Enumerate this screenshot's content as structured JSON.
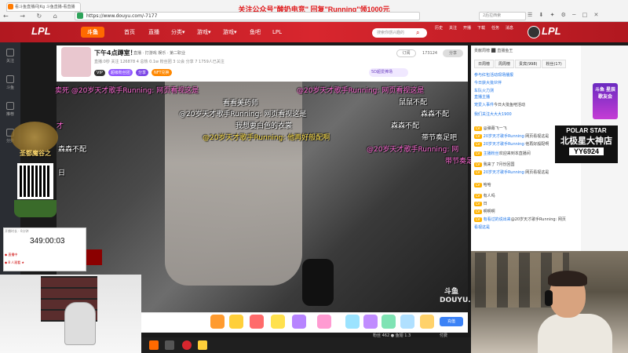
{
  "browser": {
    "tab_title": "看斗鱼直播间|Kg 斗鱼直播-看直播",
    "url": "https://www.douyu.com/-7177",
    "search_placeholder": "2后拉西索",
    "nav_glyphs": "← → ↻ ⌂"
  },
  "banner": {
    "text": "关注公众号\"酸奶电竞\" 回复\"Running\"领1000元"
  },
  "douyu_header": {
    "logo_left": "LPL",
    "logo_right": "LPL",
    "brand": "斗鱼",
    "nav": [
      "首页",
      "直播",
      "分类▾",
      "游戏▾",
      "游戏▾",
      "鱼吧",
      "LPL"
    ],
    "search_placeholder": "搜索你感兴趣的",
    "icons": [
      "历史",
      "关注",
      "开播",
      "下载",
      "任务",
      "消息"
    ]
  },
  "sidebar": {
    "items": [
      "关注",
      "斗鱼",
      "推荐",
      "分类",
      "游戏",
      "更多"
    ]
  },
  "room": {
    "title": "下午4点蹲室！",
    "meta": "直播 · 打游戏  娱乐 · 第二职业",
    "stats": "直播:0秒  关注 126878  4 总热  0.1w  粉丝团  3 公会  分享  7 1759人已关注",
    "badges": [
      "VIP",
      "超级粉丝团",
      "分享",
      "NFT兑换"
    ],
    "subscribe_label": "订阅",
    "follow_count": "173124",
    "share_label": "分享",
    "actions": "5D超爱捧场  分享  ☆  ⋯",
    "hot_label": "5D超爱捧场"
  },
  "danmu": [
    {
      "text": "卖死 @20岁天才歌手Running: 网页看视这是",
      "color": "#ff6bd6"
    },
    {
      "text": "@20岁天才歌手Running: 网页看视这是",
      "color": "#ff6bd6"
    },
    {
      "text": "看看美药师",
      "color": "#ffffff"
    },
    {
      "text": "@20岁天才歌手Running: 网页看视这是",
      "color": "#ffffff"
    },
    {
      "text": "我想要白色的衣裳",
      "color": "#ffffff"
    },
    {
      "text": "森森不配",
      "color": "#ffffff"
    },
    {
      "text": "森森不配",
      "color": "#ffffff"
    },
    {
      "text": "@20岁天才歌手Running: 他再好般配啊",
      "color": "#ffe14d"
    },
    {
      "text": "@20岁天才歌手Running: 网",
      "color": "#ff6bd6"
    },
    {
      "text": "带节奏足吧",
      "color": "#ffffff"
    },
    {
      "text": "才",
      "color": "#ff6bd6"
    },
    {
      "text": "森森不配",
      "color": "#ffffff"
    },
    {
      "text": "日",
      "color": "#ffffff"
    },
    {
      "text": "带节奏足吧",
      "color": "#ff6bd6"
    },
    {
      "text": "鼠鼠不配",
      "color": "#ffffff"
    }
  ],
  "video": {
    "watermark": "斗鱼 DOUYU.COM"
  },
  "gift_bar": {
    "info": "粉丝 462  ● 鱼翅 1.3",
    "right_btn": "充值",
    "right_label": "付费"
  },
  "chat": {
    "rank_title": "贡献周榜   ⬛ 直播鱼王",
    "tabs": [
      "日周榜",
      "周周榜",
      "贵宾(998)",
      "粉丝(17)"
    ],
    "lines": [
      {
        "lvl": "",
        "name": "参与红包活动现场播报",
        "text": ""
      },
      {
        "lvl": "",
        "name": "今日获大批伙伴",
        "text": ""
      },
      {
        "lvl": "",
        "name": "车队火力测",
        "text": ""
      },
      {
        "lvl": "",
        "name": "直播主播",
        "text": ""
      },
      {
        "lvl": "",
        "name": "宠爱入事件",
        "text": "今日大批鱼吧活动"
      },
      {
        "lvl": "",
        "name": "我们关注大大大1900",
        "text": ""
      },
      {
        "lvl": "LV",
        "name": "",
        "text": "@弹幕飞一飞"
      },
      {
        "lvl": "LV",
        "name": "20岁天才歌手Running:",
        "text": "网页看视这是"
      },
      {
        "lvl": "LV",
        "name": "20岁天才歌手Running:",
        "text": "他再好般配啊"
      },
      {
        "lvl": "LV",
        "name": "主播粉丝",
        "text": "欢迎来到本直播间"
      },
      {
        "lvl": "LV",
        "name": "",
        "text": "我来了 7月份回国"
      },
      {
        "lvl": "LV",
        "name": "20岁天才歌手Running:",
        "text": "网页看视这是"
      },
      {
        "lvl": "LV",
        "name": "",
        "text": "哈哈"
      },
      {
        "lvl": "LV",
        "name": "",
        "text": "有人吗"
      },
      {
        "lvl": "LV",
        "name": "",
        "text": "日"
      },
      {
        "lvl": "LV",
        "name": "",
        "text": "啊啊啊"
      },
      {
        "lvl": "LV",
        "name": "有看过的说出来",
        "text": "@20岁天才歌手Running: 网页"
      },
      {
        "lvl": "",
        "name": "看视这是",
        "text": ""
      }
    ]
  },
  "ad": {
    "card_text": "斗鱼 星辰 歌友会",
    "polar_line1": "POLAR STAR",
    "polar_line2": "北极星大神店",
    "polar_line3": "YY6924"
  },
  "timer": {
    "head": "开播时长 · 0分钟",
    "value": "349:00:03",
    "row1": "◆ 直播中",
    "row2": "◆ 8 人观看 ★"
  },
  "qr": {
    "title": "圣都魔谷之"
  },
  "colors": {
    "brand_red": "#d8262e",
    "orange": "#ff6a00",
    "purple": "#9157ff"
  }
}
